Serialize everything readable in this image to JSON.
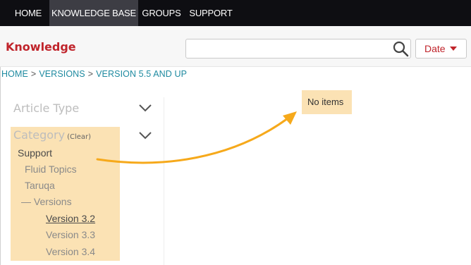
{
  "topnav": {
    "tabs": [
      {
        "label": "HOME",
        "active": false
      },
      {
        "label": "KNOWLEDGE BASE",
        "active": true
      },
      {
        "label": "GROUPS",
        "active": false
      },
      {
        "label": "SUPPORT",
        "active": false
      }
    ]
  },
  "header": {
    "brand": "Knowledge",
    "search": {
      "value": "",
      "placeholder": ""
    },
    "sort_label": "Date"
  },
  "breadcrumb": [
    "HOME",
    "VERSIONS",
    "VERSION 5.5 AND UP"
  ],
  "breadcrumb_separator": ">",
  "sidebar": {
    "article_type_label": "Article Type",
    "category_label": "Category",
    "clear_label": "(Clear)",
    "categories": [
      {
        "label": "Support"
      },
      {
        "label": "Fluid Topics"
      },
      {
        "label": "Taruqa"
      },
      {
        "label": "— Versions"
      },
      {
        "label": "Version 3.2",
        "selected": true
      },
      {
        "label": "Version 3.3"
      },
      {
        "label": "Version 3.4"
      }
    ]
  },
  "results": {
    "empty_text": "No items"
  },
  "colors": {
    "brand": "#c0242b",
    "link": "#1e8aa0",
    "highlight": "#fbe2b4",
    "arrow": "#f6a91b",
    "nav_bg": "#0e0e12",
    "nav_active": "#3d3d44"
  }
}
